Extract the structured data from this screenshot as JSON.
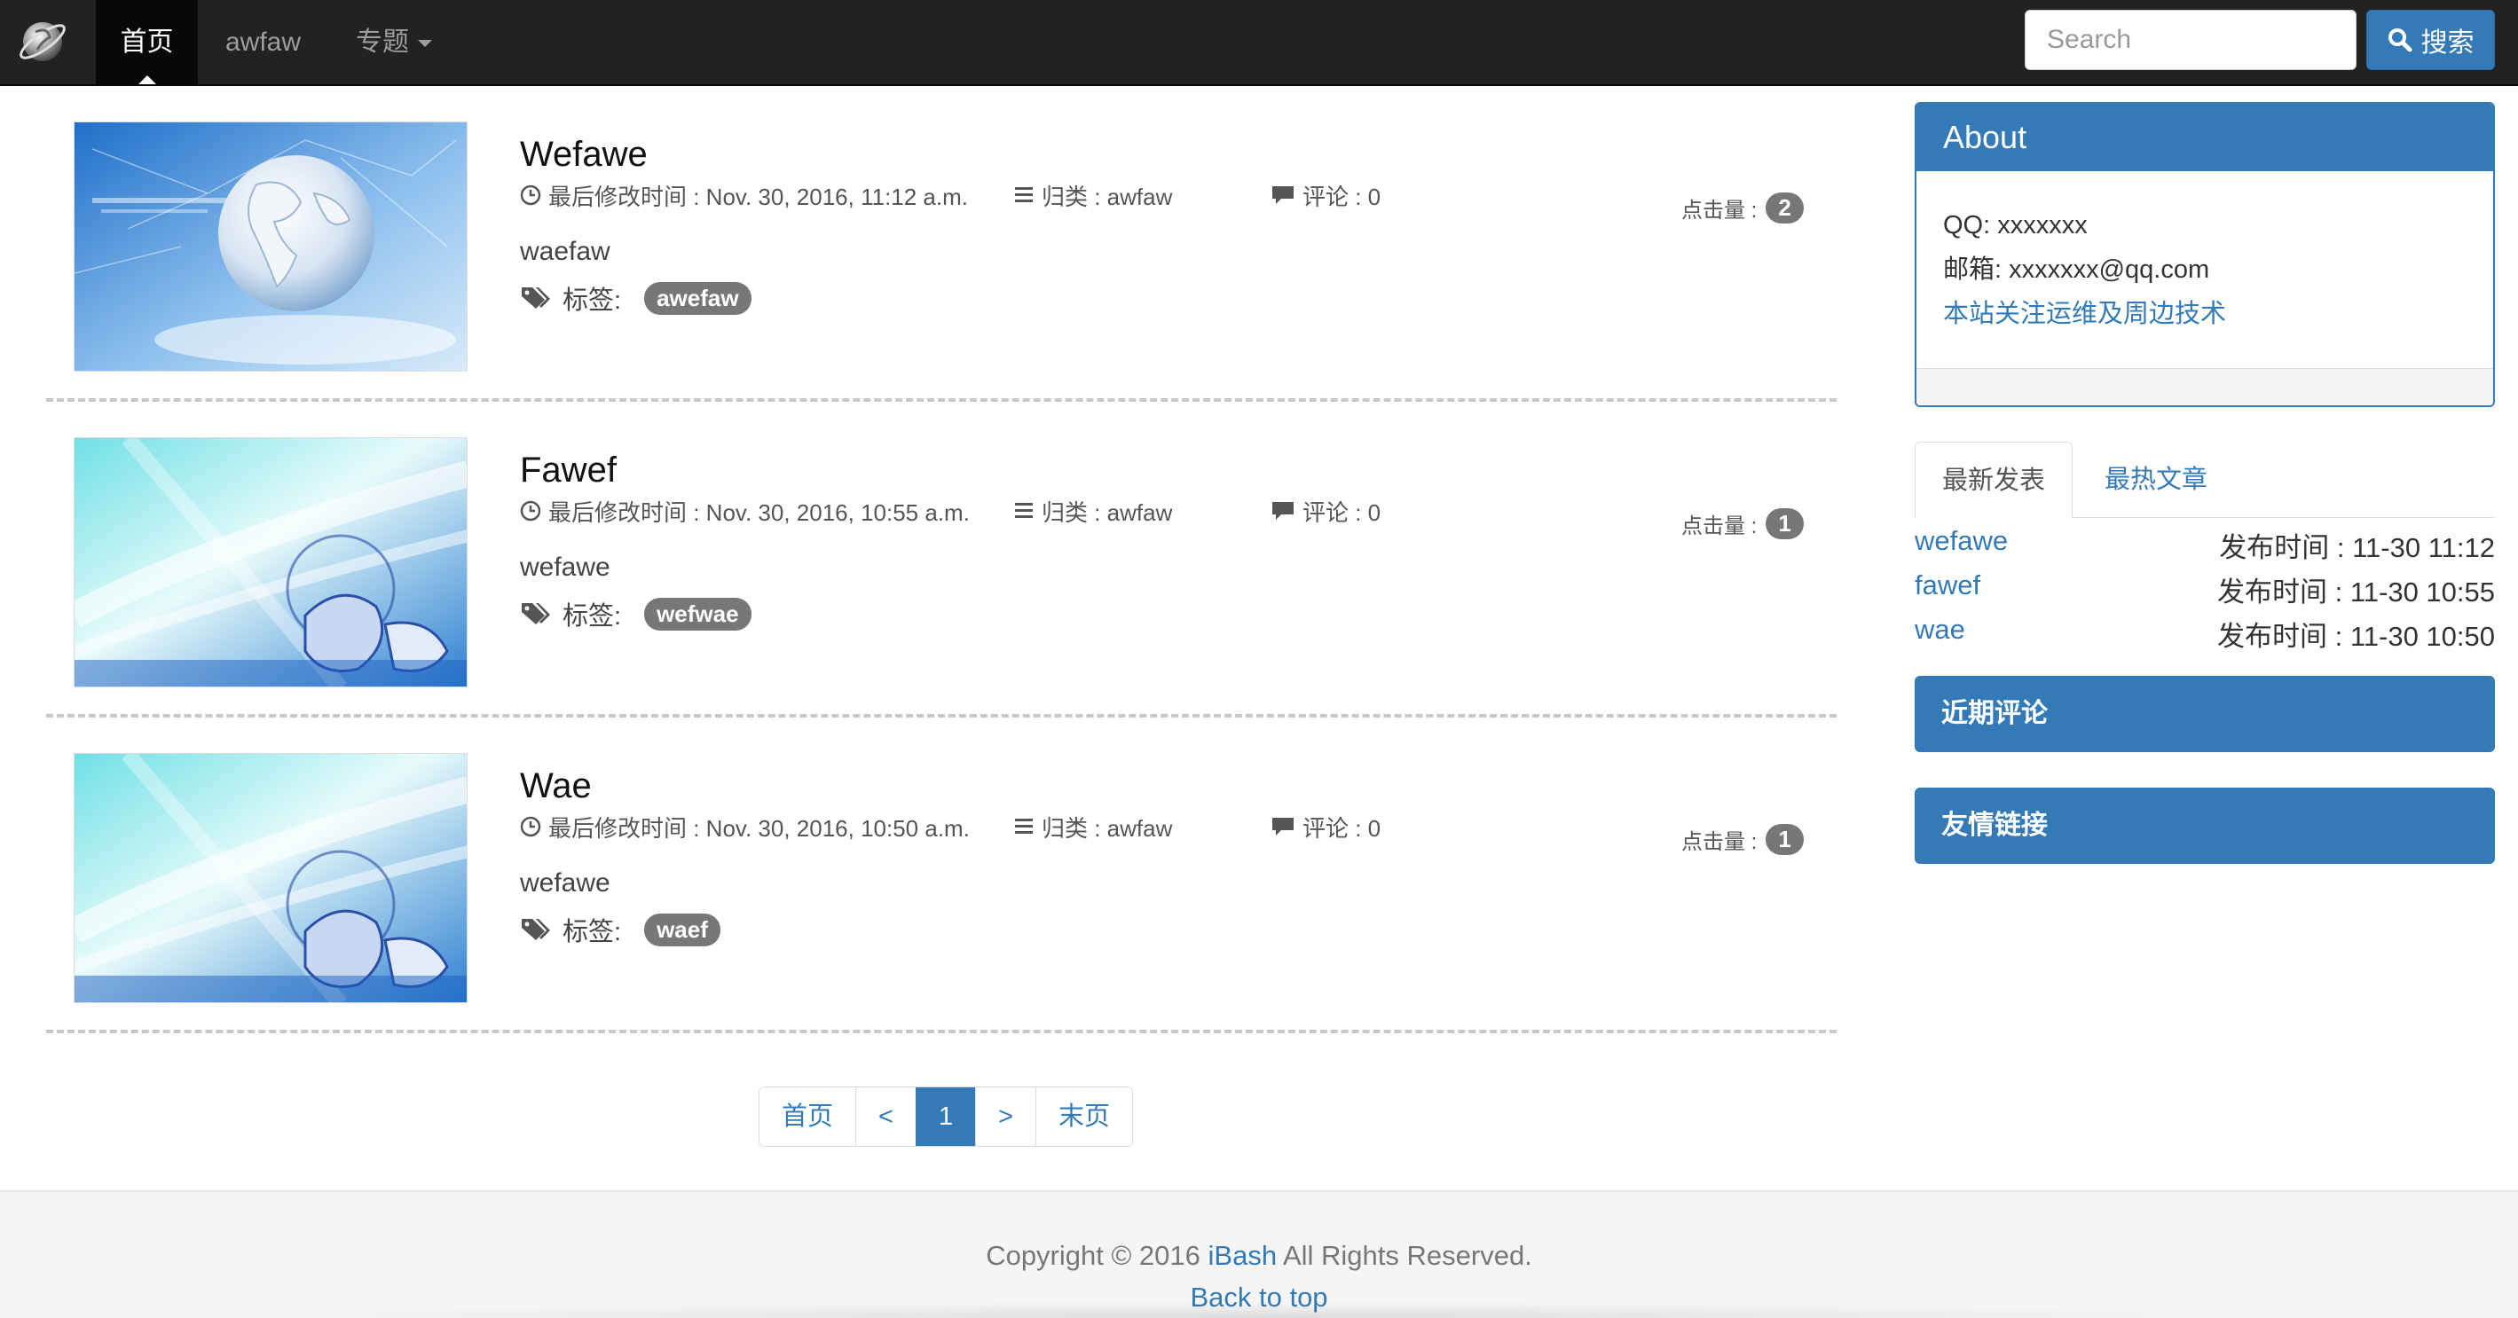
{
  "nav": {
    "items": [
      {
        "label": "首页",
        "active": true
      },
      {
        "label": "awfaw"
      },
      {
        "label": "专题"
      }
    ],
    "search_placeholder": "Search",
    "search_button": "搜索",
    "brand_color": "#222222",
    "accent_color": "#337ab7"
  },
  "posts": [
    {
      "title": "Wefawe",
      "modified_label": "最后修改时间 : Nov. 30, 2016, 11:12 a.m.",
      "category_label": "归类 : awfaw",
      "comments_label": "评论 : 0",
      "hits_label": "点击量 :",
      "hits": "2",
      "excerpt": "waefaw",
      "tags_label": "标签:",
      "tag": "awefaw",
      "image": "globe-network-image"
    },
    {
      "title": "Fawef",
      "modified_label": "最后修改时间 : Nov. 30, 2016, 10:55 a.m.",
      "category_label": "归类 : awfaw",
      "comments_label": "评论 : 0",
      "hits_label": "点击量 :",
      "hits": "1",
      "excerpt": "wefawe",
      "tags_label": "标签:",
      "tag": "wefwae",
      "image": "cyan-tech-hand-image"
    },
    {
      "title": "Wae",
      "modified_label": "最后修改时间 : Nov. 30, 2016, 10:50 a.m.",
      "category_label": "归类 : awfaw",
      "comments_label": "评论 : 0",
      "hits_label": "点击量 :",
      "hits": "1",
      "excerpt": "wefawe",
      "tags_label": "标签:",
      "tag": "waef",
      "image": "cyan-tech-hand-image"
    }
  ],
  "pagination": {
    "first": "首页",
    "prev": "<",
    "current": "1",
    "next": ">",
    "last": "末页"
  },
  "sidebar": {
    "about": {
      "title": "About",
      "qq": "QQ: xxxxxxx",
      "email": "邮箱: xxxxxxx@qq.com",
      "focus": "本站关注运维及周边技术"
    },
    "tabs": {
      "latest": "最新发表",
      "hottest": "最热文章"
    },
    "recent": [
      {
        "title": "wefawe",
        "time": "发布时间 : 11-30 11:12"
      },
      {
        "title": "fawef",
        "time": "发布时间 : 11-30 10:55"
      },
      {
        "title": "wae",
        "time": "发布时间 : 11-30 10:50"
      }
    ],
    "recent_comments": "近期评论",
    "friend_links": "友情链接"
  },
  "footer": {
    "copyright_prefix": "Copyright © 2016 ",
    "brand": "iBash",
    "copyright_suffix": " All Rights Reserved.",
    "back_to_top": "Back to top"
  }
}
